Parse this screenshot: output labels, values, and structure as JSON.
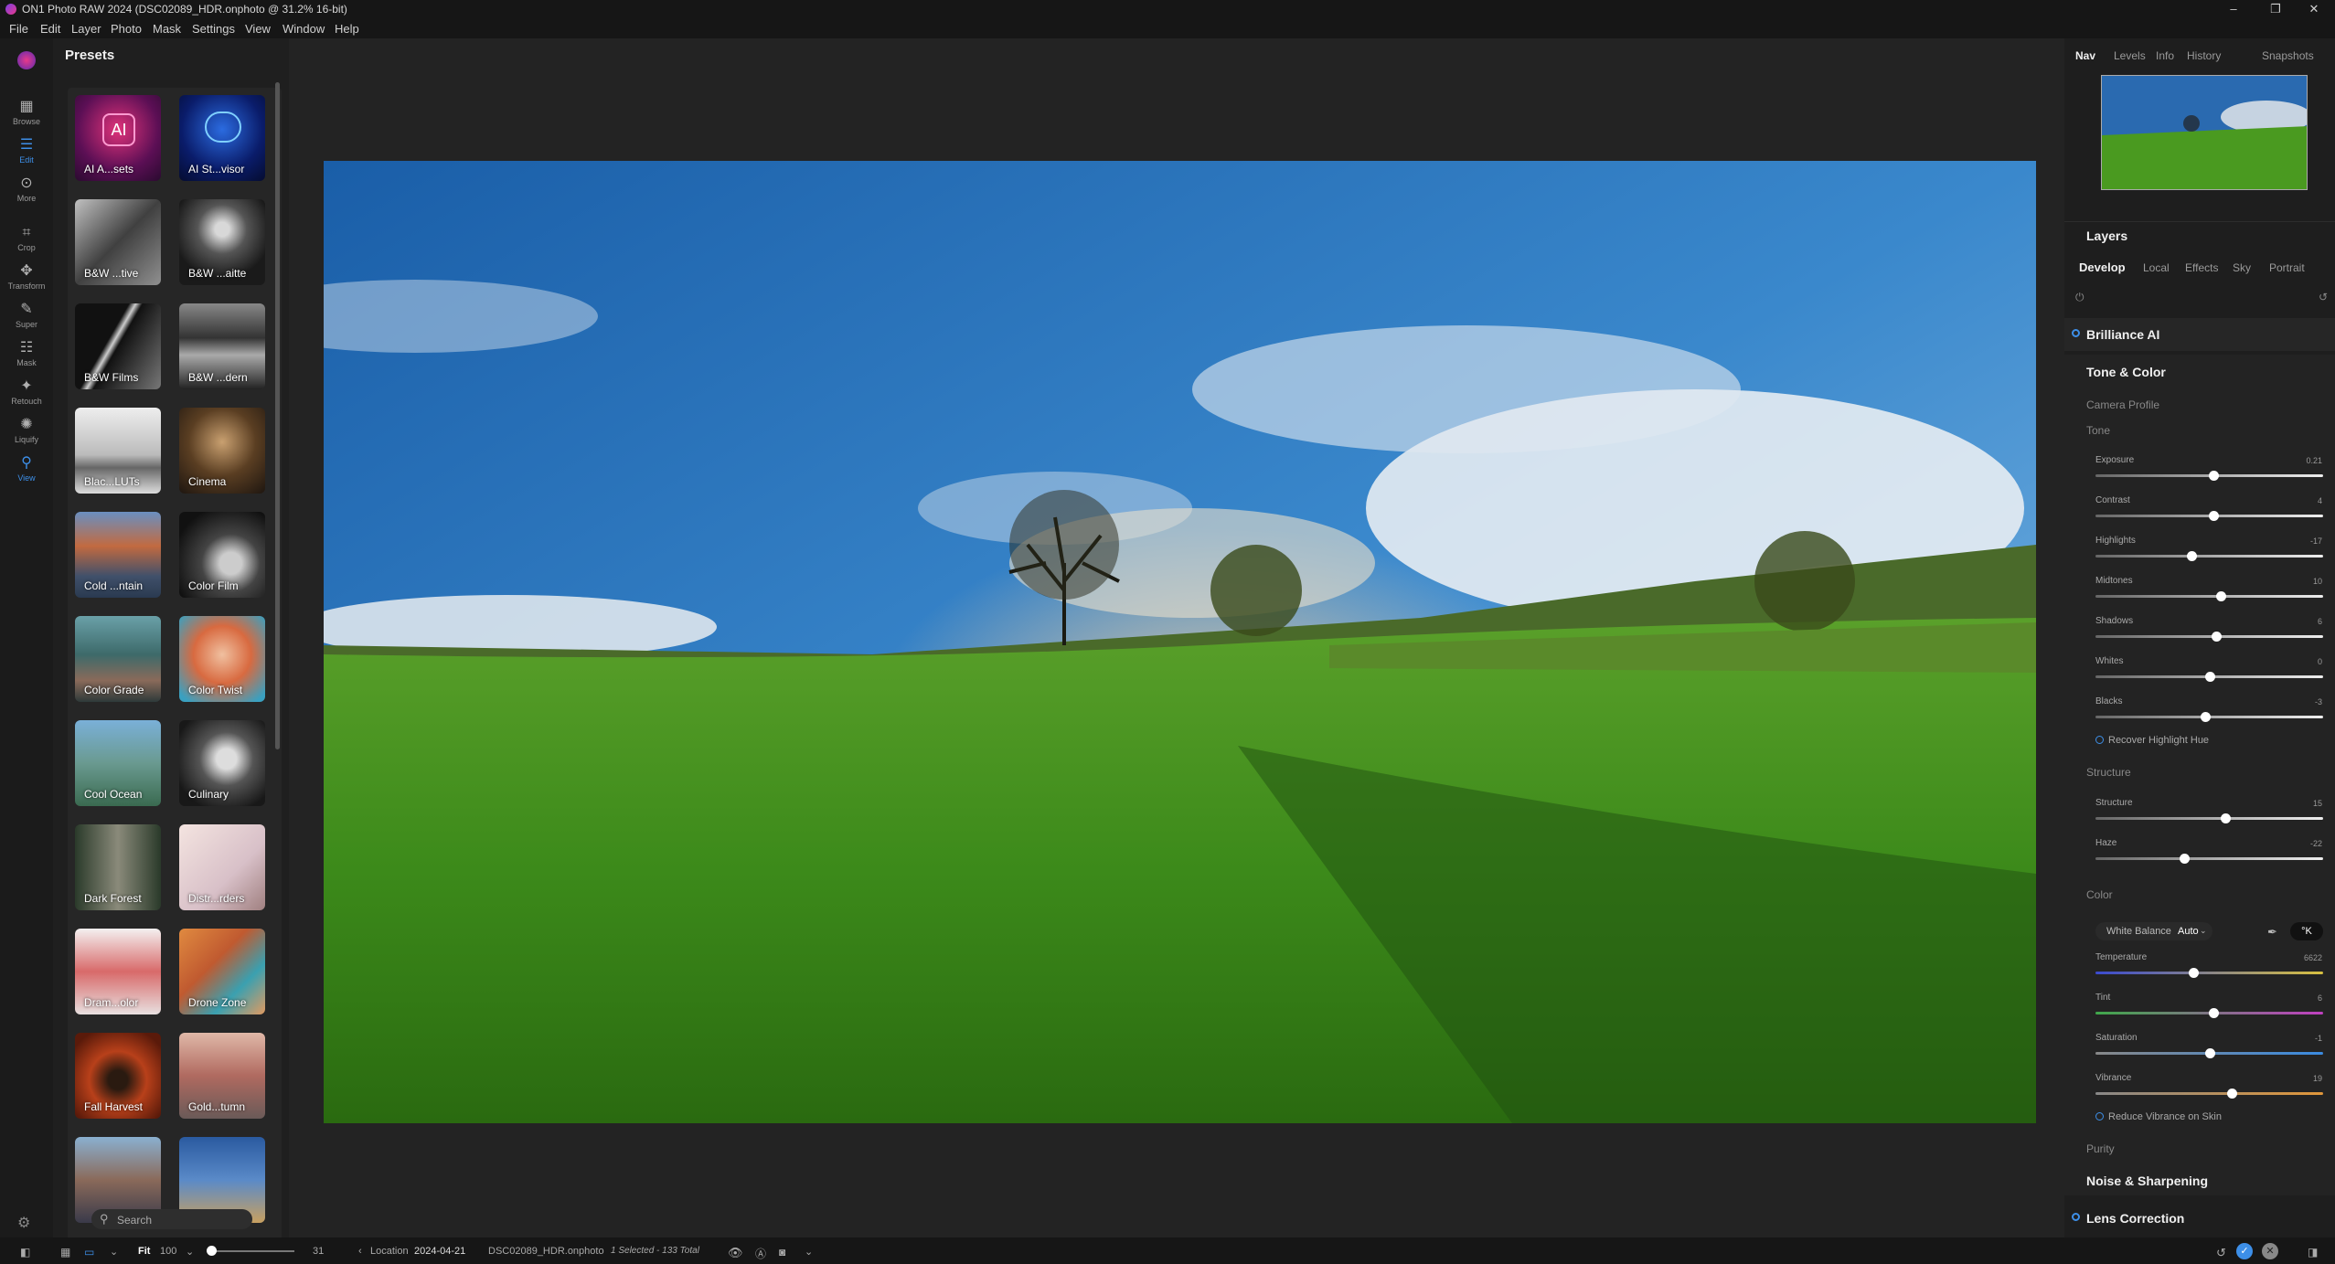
{
  "window": {
    "title": "ON1 Photo RAW 2024 (DSC02089_HDR.onphoto @ 31.2% 16-bit)",
    "controls": [
      "–",
      "❐",
      "✕"
    ]
  },
  "menu": [
    "File",
    "Edit",
    "Layer",
    "Photo",
    "Mask",
    "Settings",
    "View",
    "Window",
    "Help"
  ],
  "tools": [
    {
      "label": "Browse",
      "icon": "grid-icon"
    },
    {
      "label": "Edit",
      "icon": "sliders-icon",
      "active": true
    },
    {
      "label": "More",
      "icon": "more-icon"
    },
    {
      "label": "Crop",
      "icon": "crop-icon"
    },
    {
      "label": "Transform",
      "icon": "transform-icon"
    },
    {
      "label": "Super",
      "icon": "super-icon"
    },
    {
      "label": "Mask",
      "icon": "mask-icon"
    },
    {
      "label": "Retouch",
      "icon": "retouch-icon"
    },
    {
      "label": "Liquify",
      "icon": "liquify-icon"
    },
    {
      "label": "View",
      "icon": "view-icon",
      "active": true
    }
  ],
  "presets": {
    "title": "Presets",
    "items": [
      {
        "label": "AI A...sets"
      },
      {
        "label": "AI St...visor"
      },
      {
        "label": "B&W ...tive"
      },
      {
        "label": "B&W ...aitte"
      },
      {
        "label": "B&W Films"
      },
      {
        "label": "B&W ...dern"
      },
      {
        "label": "Blac...LUTs"
      },
      {
        "label": "Cinema"
      },
      {
        "label": "Cold ...ntain"
      },
      {
        "label": "Color Film"
      },
      {
        "label": "Color Grade"
      },
      {
        "label": "Color Twist"
      },
      {
        "label": "Cool Ocean"
      },
      {
        "label": "Culinary"
      },
      {
        "label": "Dark Forest"
      },
      {
        "label": "Distr...rders"
      },
      {
        "label": "Dram...olor"
      },
      {
        "label": "Drone Zone"
      },
      {
        "label": "Fall Harvest"
      },
      {
        "label": "Gold...tumn"
      },
      {
        "label": ""
      },
      {
        "label": ""
      }
    ],
    "search_placeholder": "Search"
  },
  "right_panel": {
    "top_tabs": [
      "Nav",
      "Levels",
      "Info",
      "History",
      "Snapshots"
    ],
    "layers_title": "Layers",
    "develop_tabs": [
      "Develop",
      "Local",
      "Effects",
      "Sky",
      "Portrait"
    ],
    "brilliance": "Brilliance AI",
    "tone_color": "Tone & Color",
    "camera_profile": "Camera Profile",
    "tone_group": "Tone",
    "tone_sliders": [
      {
        "label": "Exposure",
        "value": "0.21",
        "pos": 0.52
      },
      {
        "label": "Contrast",
        "value": "4",
        "pos": 0.52
      },
      {
        "label": "Highlights",
        "value": "-17",
        "pos": 0.42
      },
      {
        "label": "Midtones",
        "value": "10",
        "pos": 0.55
      },
      {
        "label": "Shadows",
        "value": "6",
        "pos": 0.53
      },
      {
        "label": "Whites",
        "value": "0",
        "pos": 0.5
      },
      {
        "label": "Blacks",
        "value": "-3",
        "pos": 0.48
      }
    ],
    "recover_hue": "Recover Highlight Hue",
    "structure_group": "Structure",
    "structure_sliders": [
      {
        "label": "Structure",
        "value": "15",
        "pos": 0.57
      },
      {
        "label": "Haze",
        "value": "-22",
        "pos": 0.39
      }
    ],
    "color_group": "Color",
    "white_balance": {
      "label": "White Balance",
      "value": "Auto",
      "kelvin": "°K"
    },
    "color_sliders": [
      {
        "label": "Temperature",
        "value": "6622",
        "pos": 0.43,
        "track": "linear-gradient(90deg,#3a4ad0,#d8c040)"
      },
      {
        "label": "Tint",
        "value": "6",
        "pos": 0.52,
        "track": "linear-gradient(90deg,#3fa84a,#c040c0)"
      },
      {
        "label": "Saturation",
        "value": "-1",
        "pos": 0.5,
        "track": "linear-gradient(90deg,#888,#3a8ae0)"
      },
      {
        "label": "Vibrance",
        "value": "19",
        "pos": 0.6,
        "track": "linear-gradient(90deg,#888,#e0963a)"
      }
    ],
    "reduce_vibrance": "Reduce Vibrance on Skin",
    "purity": "Purity",
    "noise": "Noise & Sharpening",
    "lens": "Lens Correction"
  },
  "bottom": {
    "fit": "Fit",
    "zoom": "100",
    "size_val": "31",
    "location_label": "Location",
    "date": "2024-04-21",
    "file": "DSC02089_HDR.onphoto",
    "selected": "1 Selected - 133 Total"
  },
  "colors": {
    "accent": "#3d8fe8",
    "panel": "#1e1e1e",
    "bg": "#1f1f1f"
  }
}
